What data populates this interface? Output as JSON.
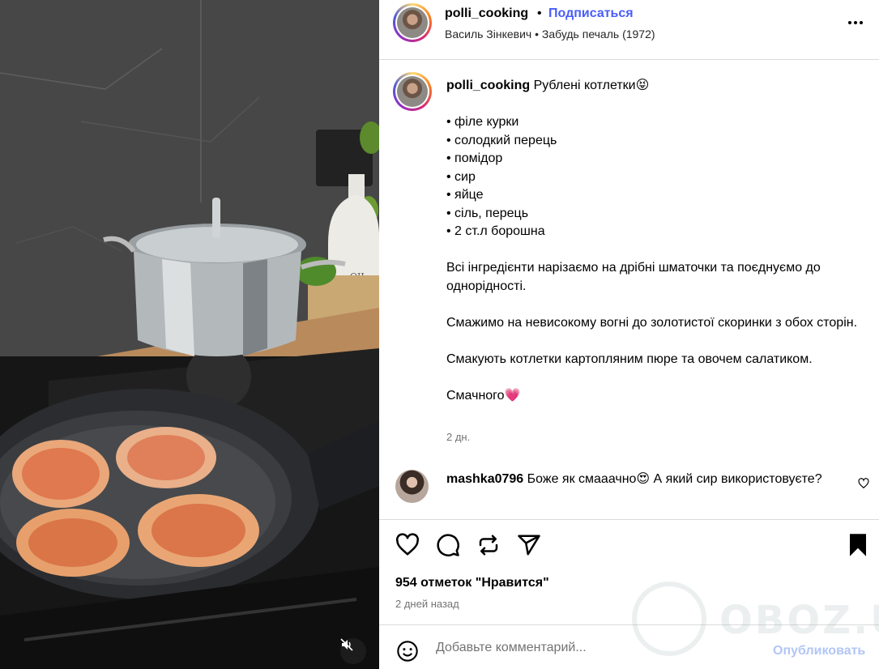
{
  "post": {
    "username": "polli_cooking",
    "follow_label": "Подписаться",
    "audio": "Василь Зінкевич • Забудь печаль (1972)",
    "caption_title": "Рублені котлетки😝",
    "ingredients": [
      "• філе курки",
      "• солодкий перець",
      "• помідор",
      "• сир",
      "• яйце",
      "• сіль, перець",
      "• 2 ст.л борошна"
    ],
    "step1": "Всі інгредієнти нарізаємо на дрібні шматочки та поєднуємо до однорідності.",
    "step2": "Смажимо на невисокому вогні до золотистої скоринки з обох сторін.",
    "step3": "Смакують котлетки картопляним пюре та овочем салатиком.",
    "closing": "Смачного💗",
    "caption_time": "2 дн."
  },
  "comment": {
    "username": "mashka0796",
    "text": "Боже як смааачно😍  А який сир використовуєте?"
  },
  "actions": {
    "likes": "954 отметок \"Нравится\"",
    "time_ago": "2 дней назад",
    "icons": [
      "heart-icon",
      "comment-icon",
      "repost-icon",
      "share-icon",
      "bookmark-icon"
    ]
  },
  "add_comment": {
    "placeholder": "Добавьте комментарий...",
    "post_label": "Опубликовать"
  },
  "watermark": {
    "text": "OBOZ.UA"
  },
  "colors": {
    "link_blue": "#4a5df9",
    "post_disabled": "#b2c6f5",
    "border": "#dbdbdb",
    "secondary_text": "#737373"
  }
}
